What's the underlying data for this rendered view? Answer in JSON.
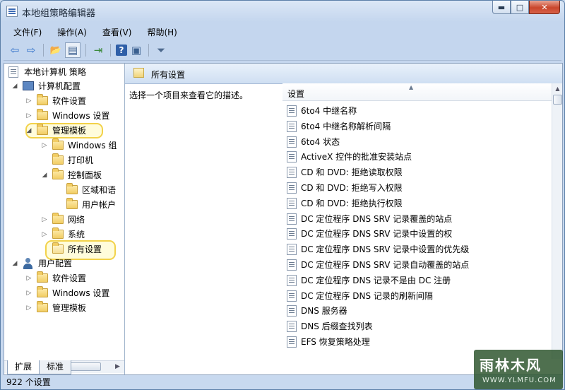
{
  "window": {
    "title": "本地组策略编辑器"
  },
  "caption": {
    "min": "▬",
    "max": "□",
    "close": "✕"
  },
  "menu": [
    {
      "label": "文件(F)"
    },
    {
      "label": "操作(A)"
    },
    {
      "label": "查看(V)"
    },
    {
      "label": "帮助(H)"
    }
  ],
  "toolbar": {
    "icons": [
      "back-arrow-icon",
      "forward-arrow-icon",
      "up-folder-icon",
      "show-hide-tree-icon",
      "export-list-icon",
      "help-icon",
      "show-action-pane-icon",
      "filter-icon"
    ],
    "glyphs": {
      "back": "⇦",
      "forward": "⇨",
      "up": "📂",
      "tree": "▤",
      "export": "⇥",
      "help": "?",
      "pane": "▣",
      "filter": "⏷"
    }
  },
  "tree": {
    "root": "本地计算机 策略",
    "computer_config": "计算机配置",
    "cc_software": "软件设置",
    "cc_windows": "Windows 设置",
    "cc_admin": "管理模板",
    "cc_admin_windows": "Windows 组",
    "cc_admin_printers": "打印机",
    "cc_admin_control_panel": "控制面板",
    "cc_cp_region": "区域和语",
    "cc_cp_user_accounts": "用户帐户",
    "cc_admin_network": "网络",
    "cc_admin_system": "系统",
    "cc_admin_all_settings": "所有设置",
    "user_config": "用户配置",
    "uc_software": "软件设置",
    "uc_windows": "Windows 设置",
    "uc_admin": "管理模板"
  },
  "right": {
    "header_title": "所有设置",
    "description": "选择一个项目来查看它的描述。",
    "column_header": "设置",
    "rows": [
      "6to4 中继名称",
      "6to4 中继名称解析间隔",
      "6to4 状态",
      "ActiveX 控件的批准安装站点",
      "CD 和 DVD: 拒绝读取权限",
      "CD 和 DVD: 拒绝写入权限",
      "CD 和 DVD: 拒绝执行权限",
      "DC 定位程序 DNS SRV 记录覆盖的站点",
      "DC 定位程序 DNS SRV 记录中设置的权",
      "DC 定位程序 DNS SRV 记录中设置的优先级",
      "DC 定位程序 DNS SRV 记录自动覆盖的站点",
      "DC 定位程序 DNS 记录不是由 DC 注册",
      "DC 定位程序 DNS 记录的刷新间隔",
      "DNS 服务器",
      "DNS 后缀查找列表",
      "EFS 恢复策略处理"
    ]
  },
  "tabs": [
    {
      "label": "扩展"
    },
    {
      "label": "标准"
    }
  ],
  "status": {
    "text": "922 个设置"
  },
  "watermark": {
    "main": "雨林木风",
    "sub": "WWW.YLMFU.COM"
  }
}
